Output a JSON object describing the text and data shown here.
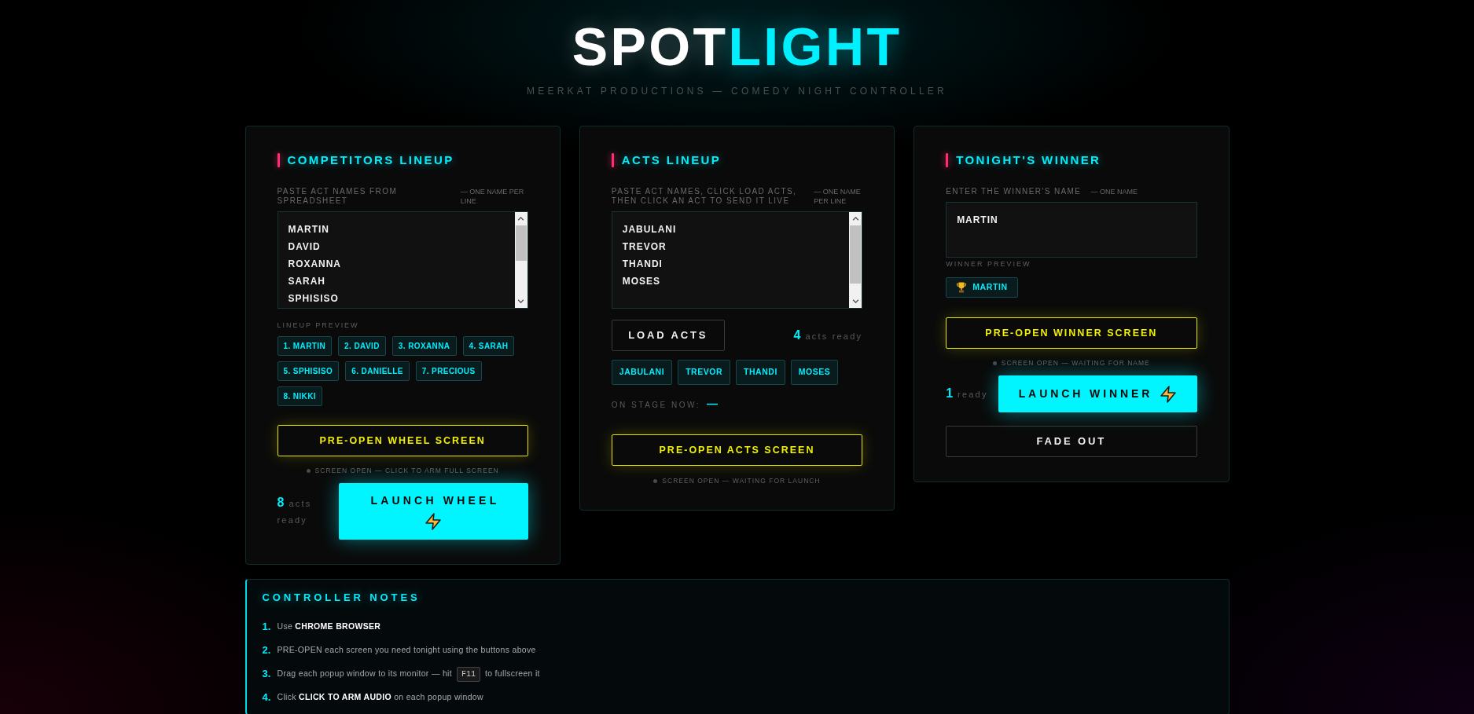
{
  "header": {
    "title": [
      {
        "text": "SPOT",
        "accent": false
      },
      {
        "text": "LIGHT",
        "accent": true
      }
    ],
    "subtitle": "MEERKAT PRODUCTIONS — COMEDY NIGHT CONTROLLER"
  },
  "competitors": {
    "title": "COMPETITORS LINEUP",
    "label": "PASTE ACT NAMES FROM SPREADSHEET",
    "hint": "— ONE NAME PER LINE",
    "names": [
      "MARTIN",
      "DAVID",
      "ROXANNA",
      "SARAH",
      "SPHISISO"
    ],
    "preview_label": "LINEUP PREVIEW",
    "preview": [
      "1. MARTIN",
      "2. DAVID",
      "3. ROXANNA",
      "4. SARAH",
      "5. SPHISISO",
      "6. DANIELLE",
      "7. PRECIOUS",
      "8. NIKKI"
    ],
    "preopen_button": "PRE-OPEN WHEEL SCREEN",
    "status": "SCREEN OPEN — CLICK TO ARM FULL SCREEN",
    "count": "8",
    "count_label": "acts ready",
    "launch_button": "LAUNCH WHEEL"
  },
  "acts": {
    "title": "ACTS LINEUP",
    "label": "PASTE ACT NAMES, CLICK LOAD ACTS, THEN CLICK AN ACT TO SEND IT LIVE",
    "hint": "— ONE NAME PER LINE",
    "names": [
      "JABULANI",
      "TREVOR",
      "THANDI",
      "MOSES"
    ],
    "load_button": "LOAD ACTS",
    "count": "4",
    "count_label": "acts ready",
    "acts": [
      {
        "name": "JABULANI",
        "selected": false
      },
      {
        "name": "TREVOR",
        "selected": false
      },
      {
        "name": "THANDI",
        "selected": false
      },
      {
        "name": "MOSES",
        "selected": false
      }
    ],
    "on_stage_label": "ON STAGE NOW:",
    "on_stage_value": "—",
    "preopen_button": "PRE-OPEN ACTS SCREEN",
    "status": "SCREEN OPEN — WAITING FOR LAUNCH"
  },
  "winner": {
    "title": "TONIGHT'S WINNER",
    "label": "ENTER THE WINNER'S NAME",
    "hint": "— ONE NAME",
    "value": "MARTIN",
    "preview_label": "WINNER PREVIEW",
    "preview": "MARTIN",
    "preopen_button": "PRE-OPEN WINNER SCREEN",
    "status": "SCREEN OPEN — WAITING FOR NAME",
    "count": "1",
    "count_label": "ready",
    "launch_button": "LAUNCH WINNER",
    "fade_button": "FADE OUT"
  },
  "notes": {
    "title": "CONTROLLER NOTES",
    "items": [
      {
        "number": "1.",
        "text": "Use **CHROME BROWSER**"
      },
      {
        "number": "2.",
        "text": "PRE-OPEN each screen you need tonight using the buttons above"
      },
      {
        "number": "3.",
        "text": "Drag each popup window to its monitor — hit",
        "key": "F11",
        "after": "to fullscreen it"
      },
      {
        "number": "4.",
        "text": "Click **CLICK TO ARM AUDIO** on each popup window"
      }
    ]
  }
}
